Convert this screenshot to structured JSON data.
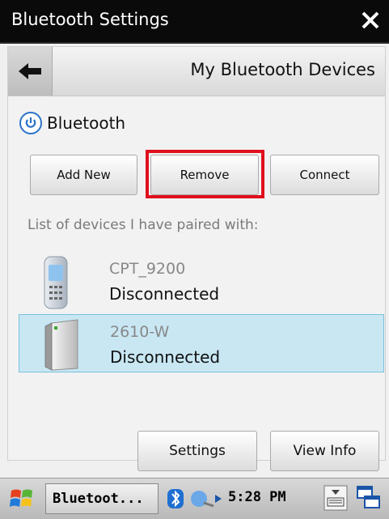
{
  "window": {
    "title": "Bluetooth Settings"
  },
  "header": {
    "title": "My Bluetooth Devices"
  },
  "bluetooth": {
    "label": "Bluetooth"
  },
  "actions": {
    "add_new": "Add New",
    "remove": "Remove",
    "connect": "Connect"
  },
  "paired": {
    "caption": "List of devices I have paired with:",
    "devices": [
      {
        "name": "CPT_9200",
        "status": "Disconnected",
        "icon": "phone-icon",
        "selected": false
      },
      {
        "name": "2610-W",
        "status": "Disconnected",
        "icon": "access-point-icon",
        "selected": true
      }
    ]
  },
  "footer": {
    "settings": "Settings",
    "view_info": "View Info"
  },
  "taskbar": {
    "task_label": "Bluetoot...",
    "time": "5:28 PM"
  },
  "colors": {
    "highlight": "#e0101c",
    "selection": "#c8e7f3",
    "accent": "#2a73c9"
  }
}
